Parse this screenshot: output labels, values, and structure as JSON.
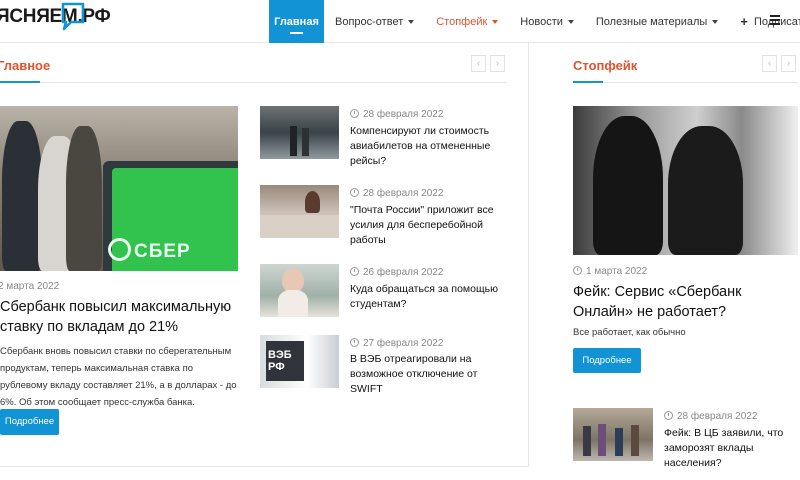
{
  "header": {
    "logo": "ЯСНЯЕМ.РФ",
    "nav": [
      {
        "label": "Главная"
      },
      {
        "label": "Вопрос-ответ"
      },
      {
        "label": "Стопфейк"
      },
      {
        "label": "Новости"
      },
      {
        "label": "Полезные материалы"
      },
      {
        "label": "Подписаться"
      }
    ]
  },
  "main_section": {
    "title": "Главное",
    "prev": "‹",
    "next": "›",
    "featured": {
      "date": "2 марта 2022",
      "title": "Сбербанк повысил максимальную ставку по вкладам до 21%",
      "text": "Сбербанк вновь повысил ставки по сберегательным продуктам, теперь максимальная ставка по рублевому вкладу составляет 21%, а в долларах - до 6%. Об этом сообщает пресс-служба банка.",
      "button": "Подробнее",
      "image_label": "СБЕР"
    },
    "items": [
      {
        "date": "28 февраля 2022",
        "title": "Компенсируют ли стоимость авиабилетов на отмененные рейсы?"
      },
      {
        "date": "28 февраля 2022",
        "title": "\"Почта России\" приложит все усилия для бесперебойной работы"
      },
      {
        "date": "26 февраля 2022",
        "title": "Куда обращаться за помощью студентам?"
      },
      {
        "date": "27 февраля 2022",
        "title": "В ВЭБ отреагировали на возможное отключение от SWIFT",
        "image_label": "ВЭБ РФ"
      }
    ]
  },
  "fake_section": {
    "title": "Стопфейк",
    "prev": "‹",
    "next": "›",
    "featured": {
      "date": "1 марта 2022",
      "title": "Фейк: Сервис «Сбербанк Онлайн» не работает?",
      "text": "Все работает, как обычно",
      "button": "Подробнее"
    },
    "items": [
      {
        "date": "28 февраля 2022",
        "title": "Фейк: В ЦБ заявили, что заморозят вклады населения?"
      }
    ]
  },
  "colors": {
    "accent": "#1193d6",
    "section_title": "#e0532f",
    "sber_green": "#32c24e"
  }
}
